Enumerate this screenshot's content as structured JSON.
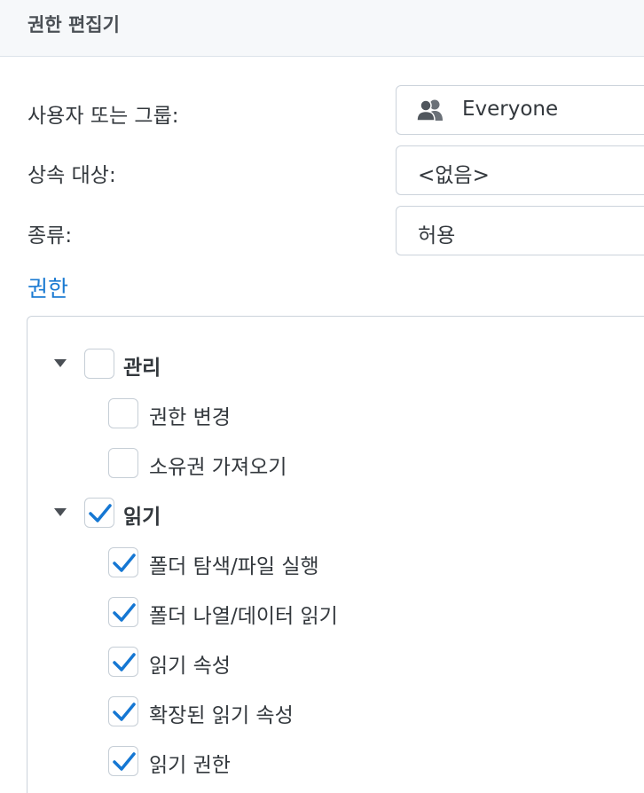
{
  "header": {
    "title": "권한 편집기"
  },
  "form": {
    "user_group_label": "사용자 또는 그룹:",
    "user_group_value": "Everyone",
    "user_group_icon": "users-icon",
    "inherit_label": "상속 대상:",
    "inherit_value": "<없음>",
    "type_label": "종류:",
    "type_value": "허용"
  },
  "permissions": {
    "section_title": "권한",
    "groups": [
      {
        "label": "관리",
        "checked": false,
        "expanded": true,
        "items": [
          {
            "label": "권한 변경",
            "checked": false
          },
          {
            "label": "소유권 가져오기",
            "checked": false
          }
        ]
      },
      {
        "label": "읽기",
        "checked": true,
        "expanded": true,
        "items": [
          {
            "label": "폴더 탐색/파일 실행",
            "checked": true
          },
          {
            "label": "폴더 나열/데이터 읽기",
            "checked": true
          },
          {
            "label": "읽기 속성",
            "checked": true
          },
          {
            "label": "확장된 읽기 속성",
            "checked": true
          },
          {
            "label": "읽기 권한",
            "checked": true
          }
        ]
      }
    ]
  },
  "colors": {
    "accent": "#1a7ad2",
    "checkmark": "#1577d3",
    "header_bg": "#f6f8fa",
    "border": "#ccd3db"
  }
}
